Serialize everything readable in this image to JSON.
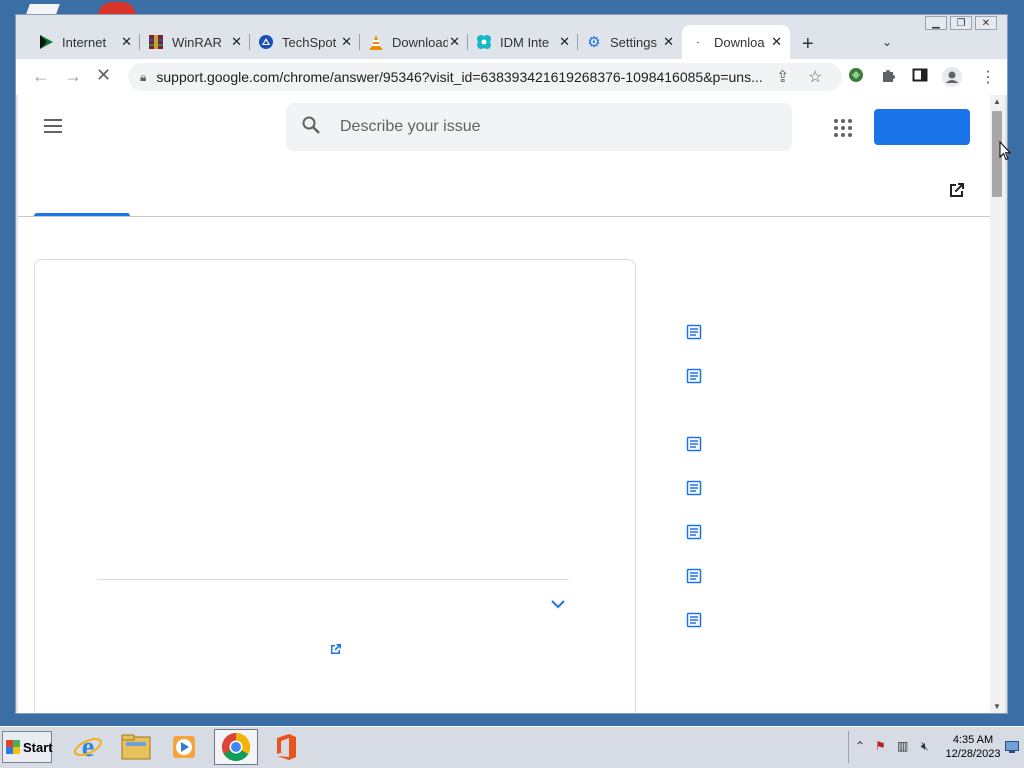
{
  "browser": {
    "tabs": [
      {
        "title": "Internet",
        "icon": "play-icon"
      },
      {
        "title": "WinRAR",
        "icon": "winrar-icon"
      },
      {
        "title": "TechSpot",
        "icon": "techspot-icon"
      },
      {
        "title": "Download",
        "icon": "vlc-cone-icon"
      },
      {
        "title": "IDM Inte",
        "icon": "idm-icon"
      },
      {
        "title": "Settings",
        "icon": "gear-icon"
      },
      {
        "title": "Downloa",
        "icon": "loading-icon",
        "active": true
      }
    ],
    "url": "support.google.com/chrome/answer/95346?visit_id=638393421619268376-1098416085&p=uns..."
  },
  "page": {
    "search_placeholder": "Describe your issue",
    "accent_color": "#1a73e8"
  },
  "taskbar": {
    "start_label": "Start",
    "time": "4:35 AM",
    "date": "12/28/2023"
  }
}
